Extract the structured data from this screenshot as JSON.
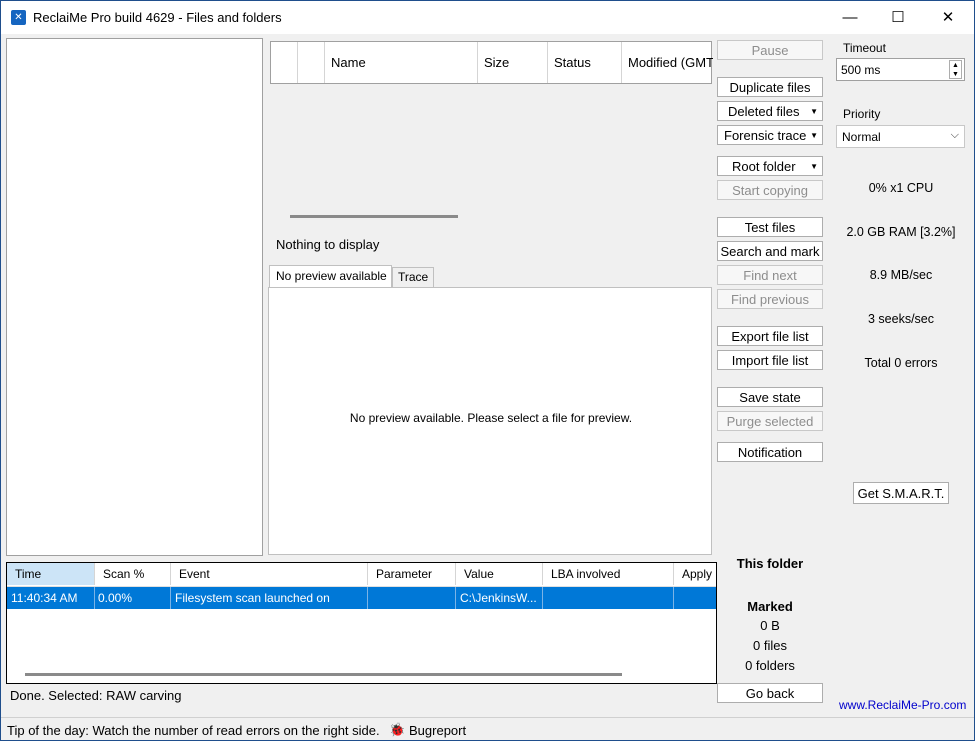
{
  "window": {
    "title": "ReclaiMe Pro build 4629 - Files and folders",
    "controls": {
      "minimize": "—",
      "maximize": "☐",
      "close": "✕"
    }
  },
  "file_table": {
    "columns": [
      "",
      "",
      "Name",
      "Size",
      "Status",
      "Modified (GMT"
    ]
  },
  "empty_message": "Nothing to display",
  "preview": {
    "tabs": [
      "No preview available",
      "Trace"
    ],
    "message": "No preview available. Please select a file for preview."
  },
  "buttons": {
    "pause": "Pause",
    "duplicate_files": "Duplicate files",
    "deleted_files": "Deleted files",
    "forensic_trace": "Forensic trace",
    "root_folder": "Root folder",
    "start_copying": "Start copying",
    "test_files": "Test files",
    "search_and_mark": "Search and mark",
    "find_next": "Find next",
    "find_previous": "Find previous",
    "export_file_list": "Export file list",
    "import_file_list": "Import file list",
    "save_state": "Save state",
    "purge_selected": "Purge selected",
    "notification": "Notification",
    "go_back": "Go back",
    "get_smart": "Get S.M.A.R.T."
  },
  "settings": {
    "timeout_label": "Timeout",
    "timeout_value": "500 ms",
    "priority_label": "Priority",
    "priority_value": "Normal"
  },
  "stats": {
    "cpu": "0% x1 CPU",
    "ram": "2.0 GB RAM [3.2%]",
    "speed": "8.9 MB/sec",
    "seeks": "3 seeks/sec",
    "errors": "Total 0 errors"
  },
  "folder_info": {
    "this_folder": "This folder",
    "marked": "Marked",
    "size": "0 B",
    "files": "0 files",
    "folders": "0 folders"
  },
  "log": {
    "columns": [
      "Time",
      "Scan %",
      "Event",
      "Parameter",
      "Value",
      "LBA involved",
      "Apply"
    ],
    "rows": [
      [
        "11:40:34 AM",
        "0.00%",
        "Filesystem scan launched on",
        "",
        "C:\\JenkinsW...",
        "",
        ""
      ]
    ]
  },
  "status_bar": {
    "status": "Done.  Selected: RAW carving",
    "tip": "Tip of the day: Watch the number of read errors on the right side.",
    "bugreport": "Bugreport"
  },
  "website": "www.ReclaiMe-Pro.com",
  "colors": {
    "selection": "#0078d7",
    "link": "#0000cc",
    "header_highlight": "#cce4f7"
  }
}
